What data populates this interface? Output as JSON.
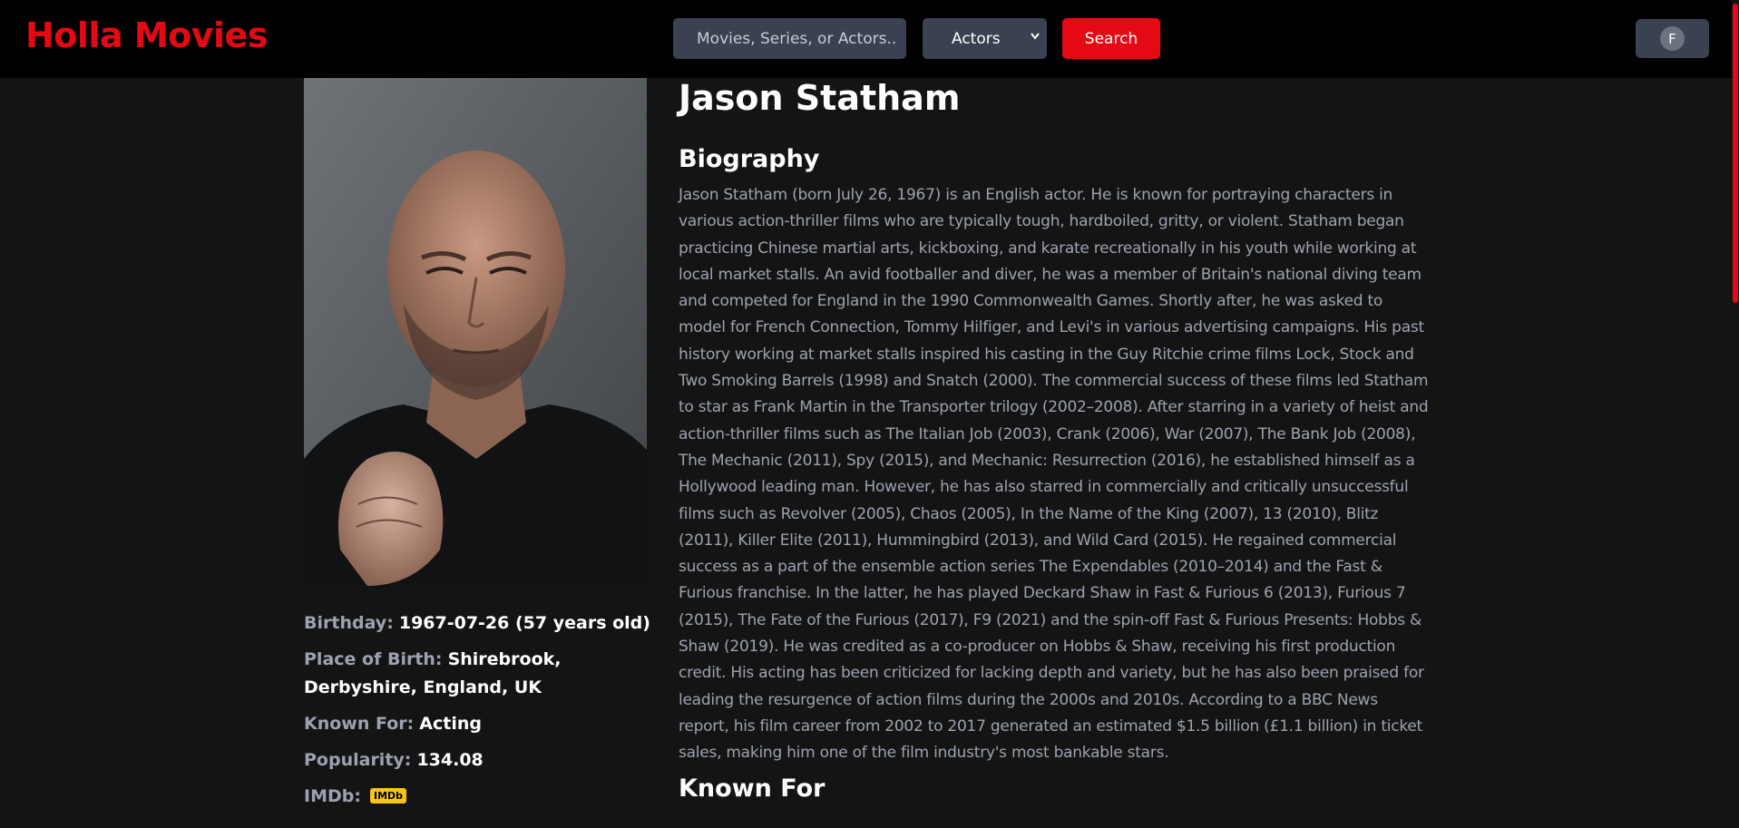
{
  "header": {
    "logo": "Holla Movies",
    "search_placeholder": "Movies, Series, or Actors..",
    "search_type": "Actors",
    "search_button": "Search",
    "profile_initial": "F"
  },
  "person": {
    "name": "Jason Statham",
    "photo_alt": "Jason Statham",
    "details": {
      "birthday_label": "Birthday:",
      "birthday_value": "1967-07-26 (57 years old)",
      "birthplace_label": "Place of Birth:",
      "birthplace_value": "Shirebrook, Derbyshire, England, UK",
      "known_for_label": "Known For:",
      "known_for_value": "Acting",
      "popularity_label": "Popularity:",
      "popularity_value": "134.08",
      "imdb_label": "IMDb:",
      "imdb_badge": "IMDb"
    },
    "biography_heading": "Biography",
    "biography": "Jason Statham (born July 26, 1967) is an English actor. He is known for portraying characters in various action-thriller films who are typically tough, hardboiled, gritty, or violent. Statham began practicing Chinese martial arts, kickboxing, and karate recreationally in his youth while working at local market stalls. An avid footballer and diver, he was a member of Britain's national diving team and competed for England in the 1990 Commonwealth Games. Shortly after, he was asked to model for French Connection, Tommy Hilfiger, and Levi's in various advertising campaigns. His past history working at market stalls inspired his casting in the Guy Ritchie crime films Lock, Stock and Two Smoking Barrels (1998) and Snatch (2000). The commercial success of these films led Statham to star as Frank Martin in the Transporter trilogy (2002–2008). After starring in a variety of heist and action-thriller films such as The Italian Job (2003), Crank (2006), War (2007), The Bank Job (2008), The Mechanic (2011), Spy (2015), and Mechanic: Resurrection (2016), he established himself as a Hollywood leading man. However, he has also starred in commercially and critically unsuccessful films such as Revolver (2005), Chaos (2005), In the Name of the King (2007), 13 (2010), Blitz (2011), Killer Elite (2011), Hummingbird (2013), and Wild Card (2015). He regained commercial success as a part of the ensemble action series The Expendables (2010–2014) and the Fast & Furious franchise. In the latter, he has played Deckard Shaw in Fast & Furious 6 (2013), Furious 7 (2015), The Fate of the Furious (2017), F9 (2021) and the spin-off Fast & Furious Presents: Hobbs & Shaw (2019). He was credited as a co-producer on Hobbs & Shaw, receiving his first production credit. His acting has been criticized for lacking depth and variety, but he has also been praised for leading the resurgence of action films during the 2000s and 2010s. According to a BBC News report, his film career from 2002 to 2017 generated an estimated $1.5 billion (£1.1 billion) in ticket sales, making him one of the film industry's most bankable stars.",
    "known_for_heading": "Known For"
  },
  "colors": {
    "brand": "#e50914",
    "background": "#141414",
    "header_bg": "#000000",
    "control_bg": "#3a4150",
    "muted_text": "#9ca3af",
    "imdb_yellow": "#f5c518"
  },
  "icons": {
    "select_chevron": "chevron-down-icon"
  }
}
